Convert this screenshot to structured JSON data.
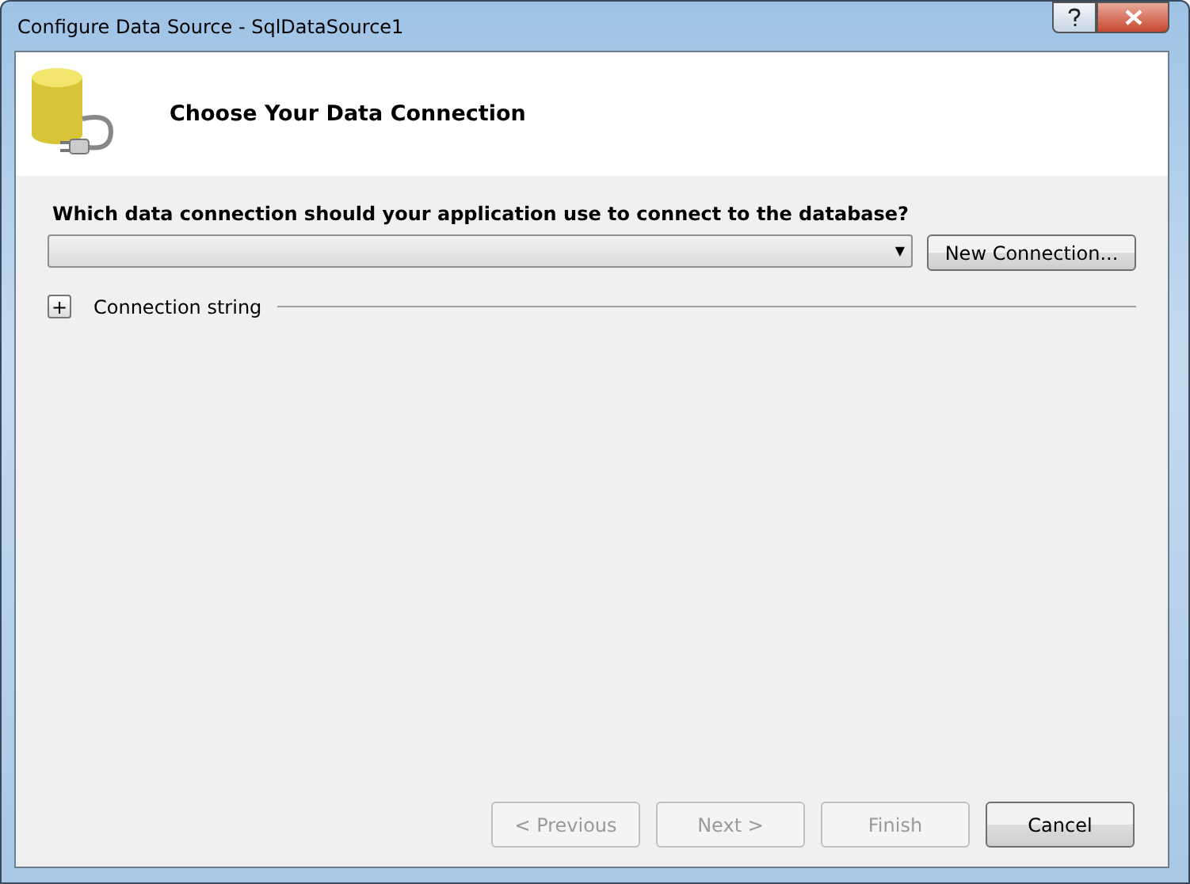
{
  "window": {
    "title": "Configure Data Source - SqlDataSource1"
  },
  "header": {
    "title": "Choose Your Data Connection"
  },
  "prompt": "Which data connection should your application use to connect to the database?",
  "connection_dropdown": {
    "arrow": "▼"
  },
  "new_connection_button": "New Connection...",
  "connection_string": {
    "expander": "+",
    "label": "Connection string"
  },
  "buttons": [
    {
      "label": "< Previous",
      "disabled": true
    },
    {
      "label": "Next >",
      "disabled": true
    },
    {
      "label": "Finish",
      "disabled": true
    },
    {
      "label": "Cancel",
      "disabled": false
    }
  ]
}
